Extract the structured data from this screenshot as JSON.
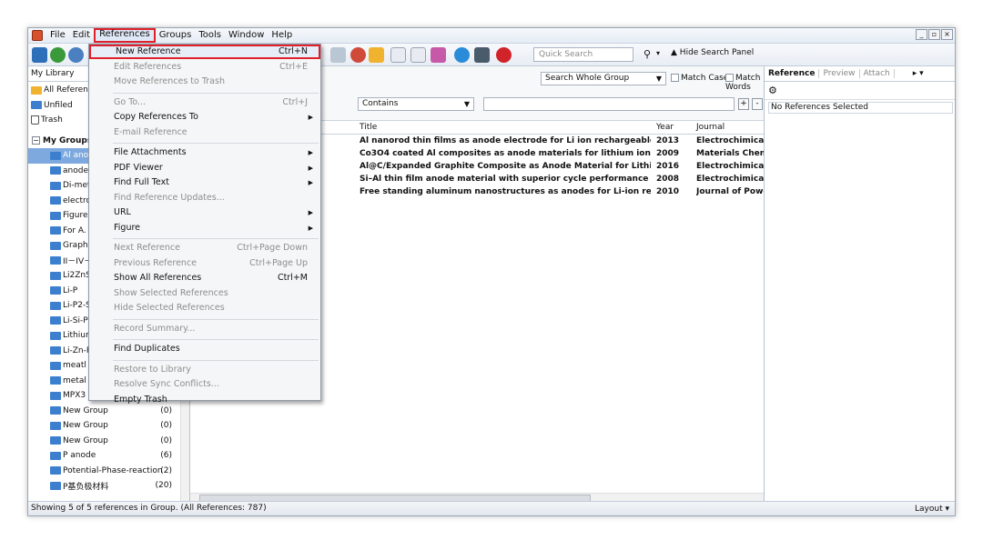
{
  "menubar": {
    "items": [
      "File",
      "Edit",
      "References",
      "Groups",
      "Tools",
      "Window",
      "Help"
    ],
    "window_controls": [
      "_",
      "▫",
      "×"
    ]
  },
  "toolbar": {
    "quick_search_placeholder": "Quick Search",
    "search_icon": "⚲",
    "dropdown_arrow": "▾",
    "hide_search_label": "Hide Search Panel",
    "hide_search_icon": "▲"
  },
  "left_panel": {
    "header": "My Library",
    "items": [
      {
        "label": "All References",
        "type": "gold"
      },
      {
        "label": "Unfiled",
        "type": "folder"
      },
      {
        "label": "Trash",
        "type": "trash"
      }
    ],
    "groups_title": "My Groups",
    "groups": [
      {
        "label": "Al anode",
        "count": ""
      },
      {
        "label": "anode m",
        "count": ""
      },
      {
        "label": "Di-meta",
        "count": ""
      },
      {
        "label": "electros",
        "count": ""
      },
      {
        "label": "Figures",
        "count": ""
      },
      {
        "label": "For A. E.",
        "count": ""
      },
      {
        "label": "Graphite",
        "count": ""
      },
      {
        "label": "II－IV－",
        "count": ""
      },
      {
        "label": "Li2ZnSi",
        "count": ""
      },
      {
        "label": "Li-P",
        "count": ""
      },
      {
        "label": "Li-P2-Si",
        "count": ""
      },
      {
        "label": "Li-Si-P s",
        "count": ""
      },
      {
        "label": "Lithium",
        "count": ""
      },
      {
        "label": "Li-Zn-P",
        "count": ""
      },
      {
        "label": "meatl ar",
        "count": ""
      },
      {
        "label": "metal o:",
        "count": ""
      },
      {
        "label": "MPX3",
        "count": ""
      },
      {
        "label": "New Group",
        "count": "(0)"
      },
      {
        "label": "New Group",
        "count": "(0)"
      },
      {
        "label": "New Group",
        "count": "(0)"
      },
      {
        "label": "P anode",
        "count": "(6)"
      },
      {
        "label": "Potential-Phase-reaction",
        "count": "(2)"
      },
      {
        "label": "P基负极材料",
        "count": "(20)"
      }
    ]
  },
  "search_panel": {
    "scope": "Search Whole Group",
    "match_case": "Match Case",
    "match_words": "Match Words",
    "operator": "Contains",
    "plus": "+",
    "minus": "-"
  },
  "table": {
    "columns": [
      "Title",
      "Year",
      "Journal"
    ],
    "rows": [
      {
        "title": "Al nanorod thin films as anode electrode for Li ion rechargeable batteries",
        "year": "2013",
        "journal": "Electrochimica Acta"
      },
      {
        "title": "Co3O4 coated Al composites as anode materials for lithium ion batteries",
        "year": "2009",
        "journal": "Materials Chemistry and"
      },
      {
        "title": "Al@C/Expanded Graphite Composite as Anode Material for Lithium Ion Bat...",
        "year": "2016",
        "journal": "Electrochimica Acta"
      },
      {
        "title": "Si–Al thin film anode material with superior cycle performance and rate ca...",
        "year": "2008",
        "journal": "Electrochimica Acta"
      },
      {
        "title": "Free standing aluminum nanostructures as anodes for Li-ion rechargeable b...",
        "year": "2010",
        "journal": "Journal of Power Source"
      }
    ]
  },
  "right_panel": {
    "tabs": [
      "Reference",
      "Preview",
      "Attach"
    ],
    "gear_icon": "⚙",
    "no_selection": "No References Selected"
  },
  "status": {
    "text": "Showing 5 of 5 references in Group. (All References: 787)",
    "layout_label": "Layout"
  },
  "references_menu": {
    "items": [
      {
        "label": "New Reference",
        "shortcut": "Ctrl+N",
        "disabled": false,
        "highlighted": true
      },
      {
        "label": "Edit References",
        "shortcut": "Ctrl+E",
        "disabled": true
      },
      {
        "label": "Move References to Trash",
        "shortcut": "",
        "disabled": true
      },
      {
        "label": "Go To...",
        "shortcut": "Ctrl+J",
        "disabled": true
      },
      {
        "label": "Copy References To",
        "shortcut": "",
        "disabled": false,
        "submenu": true
      },
      {
        "label": "E-mail Reference",
        "shortcut": "",
        "disabled": true
      },
      {
        "label": "File Attachments",
        "shortcut": "",
        "disabled": false,
        "submenu": true
      },
      {
        "label": "PDF Viewer",
        "shortcut": "",
        "disabled": false,
        "submenu": true
      },
      {
        "label": "Find Full Text",
        "shortcut": "",
        "disabled": false,
        "submenu": true
      },
      {
        "label": "Find Reference Updates...",
        "shortcut": "",
        "disabled": true
      },
      {
        "label": "URL",
        "shortcut": "",
        "disabled": false,
        "submenu": true
      },
      {
        "label": "Figure",
        "shortcut": "",
        "disabled": false,
        "submenu": true
      },
      {
        "label": "Next Reference",
        "shortcut": "Ctrl+Page Down",
        "disabled": true
      },
      {
        "label": "Previous Reference",
        "shortcut": "Ctrl+Page Up",
        "disabled": true
      },
      {
        "label": "Show All References",
        "shortcut": "Ctrl+M",
        "disabled": false
      },
      {
        "label": "Show Selected References",
        "shortcut": "",
        "disabled": true
      },
      {
        "label": "Hide Selected References",
        "shortcut": "",
        "disabled": true
      },
      {
        "label": "Record Summary...",
        "shortcut": "",
        "disabled": true
      },
      {
        "label": "Find Duplicates",
        "shortcut": "",
        "disabled": false
      },
      {
        "label": "Restore to Library",
        "shortcut": "",
        "disabled": true
      },
      {
        "label": "Resolve Sync Conflicts...",
        "shortcut": "",
        "disabled": true
      },
      {
        "label": "Empty Trash",
        "shortcut": "",
        "disabled": false
      }
    ]
  },
  "colors": {
    "highlight_red": "#e0202a",
    "selection_blue": "#7ea9de",
    "folder_blue": "#3d7fcf"
  }
}
